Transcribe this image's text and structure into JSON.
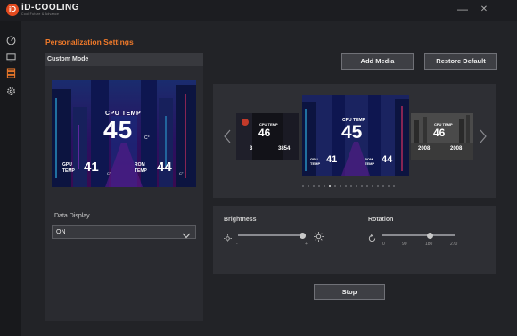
{
  "app": {
    "logo_mark": "iD",
    "logo_name": "iD-COOLING",
    "logo_tag": "Cool Future & Advance",
    "icons": [
      "speedometer-icon",
      "monitor-icon",
      "lcd-stack-icon",
      "settings-icon"
    ]
  },
  "window": {
    "minimize": "—",
    "close": "✕"
  },
  "page": {
    "heading": "Personalization Settings",
    "mode_label": "Custom Mode",
    "add_media": "Add Media",
    "restore_default": "Restore Default",
    "stop": "Stop"
  },
  "preview": {
    "cpu_label": "CPU TEMP",
    "cpu_value": "45",
    "unit": "C°",
    "gpu_label_1": "GPU",
    "gpu_label_2": "TEMP",
    "gpu_value": "41",
    "rom_label_1": "ROM",
    "rom_label_2": "TEMP",
    "rom_value": "44"
  },
  "thumbs": {
    "left_cpu_label": "CPU TEMP",
    "left_value": "46",
    "left_small_1": "3",
    "left_small_2": "3854",
    "right_cpu_label": "CPU TEMP",
    "right_value": "46",
    "right_small_1": "2008",
    "right_small_2": "2008"
  },
  "data_display": {
    "label": "Data Display",
    "value": "ON"
  },
  "brightness": {
    "label": "Brightness",
    "min_mark": "-",
    "max_mark": "+",
    "level": 0.95
  },
  "rotation": {
    "label": "Rotation",
    "ticks": [
      "0",
      "90",
      "180",
      "270"
    ],
    "selected": "180"
  },
  "carousel": {
    "slide_count": 18,
    "active_index": 5
  },
  "colors": {
    "accent": "#f07a2a",
    "bg": "#222327",
    "panel": "#2e2f34"
  }
}
